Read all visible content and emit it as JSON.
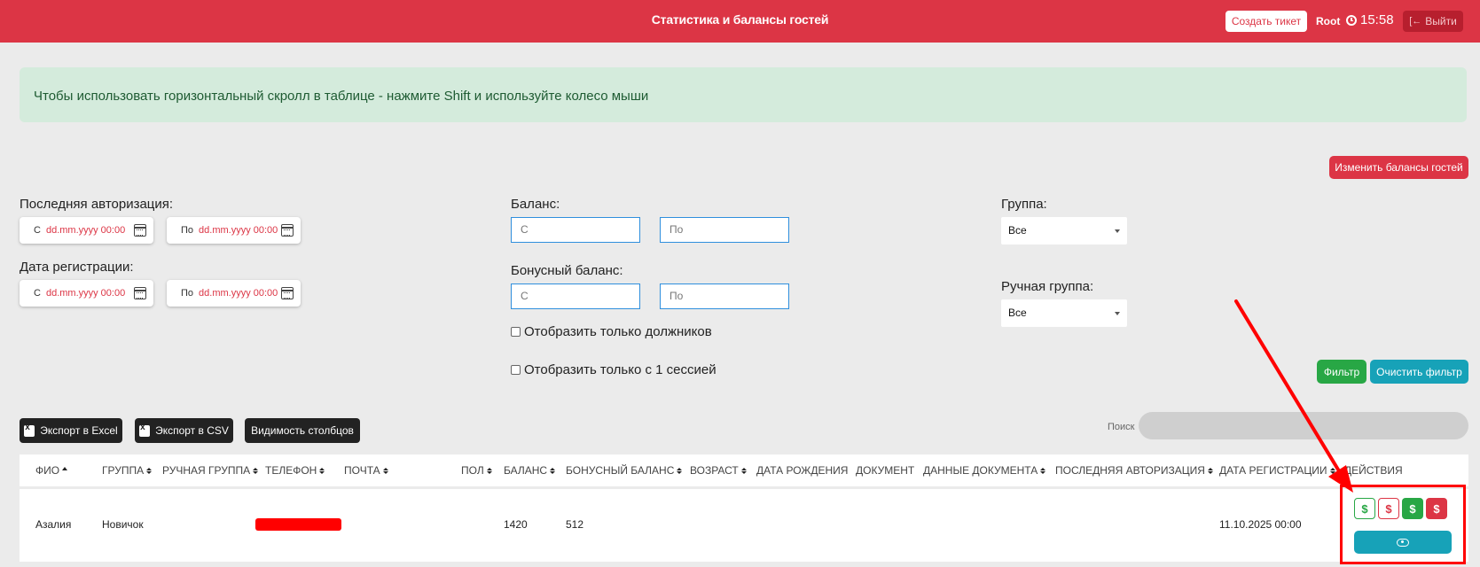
{
  "header": {
    "title": "Статистика и балансы гостей",
    "create_ticket": "Создать тикет",
    "user": "Root",
    "time": "15:58",
    "logout": "Выйти"
  },
  "alert": {
    "text": "Чтобы использовать горизонтальный скролл в таблице - нажмите Shift и используйте колесо мыши"
  },
  "change_balances_label": "Изменить балансы гостей",
  "filters": {
    "last_auth_label": "Последняя авторизация:",
    "reg_date_label": "Дата регистрации:",
    "from_prefix": "С",
    "to_prefix": "По",
    "date_placeholder": "dd.mm.yyyy 00:00",
    "balance_label": "Баланс:",
    "bonus_balance_label": "Бонусный баланс:",
    "from_placeholder": "С",
    "to_placeholder": "По",
    "only_debtors": "Отобразить только должников",
    "only_one_session": "Отобразить только с 1 сессией",
    "group_label": "Группа:",
    "group_value": "Все",
    "manual_group_label": "Ручная группа:",
    "manual_group_value": "Все",
    "filter_button": "Фильтр",
    "clear_button": "Очистить фильтр"
  },
  "toolbar": {
    "export_excel": "Экспорт в Excel",
    "export_csv": "Экспорт в CSV",
    "columns_visibility": "Видимость столбцов",
    "search_label": "Поиск"
  },
  "table": {
    "columns": [
      "ФИО",
      "Группа",
      "Ручная группа",
      "Телефон",
      "Почта",
      "Пол",
      "Баланс",
      "Бонусный баланс",
      "Возраст",
      "Дата рождения",
      "Документ",
      "Данные документа",
      "Последняя авторизация",
      "Дата регистрации",
      "Действия"
    ],
    "rows": [
      {
        "name": "Азалия",
        "group": "Новичок",
        "manual_group": "",
        "balance": "1420",
        "bonus_balance": "512",
        "reg_date": "11.10.2025 00:00"
      }
    ],
    "action_symbol": "$"
  },
  "colors": {
    "primary_red": "#dc3545",
    "success_green": "#28a745",
    "info_teal": "#17a2b8",
    "highlight": "#ff0000"
  }
}
